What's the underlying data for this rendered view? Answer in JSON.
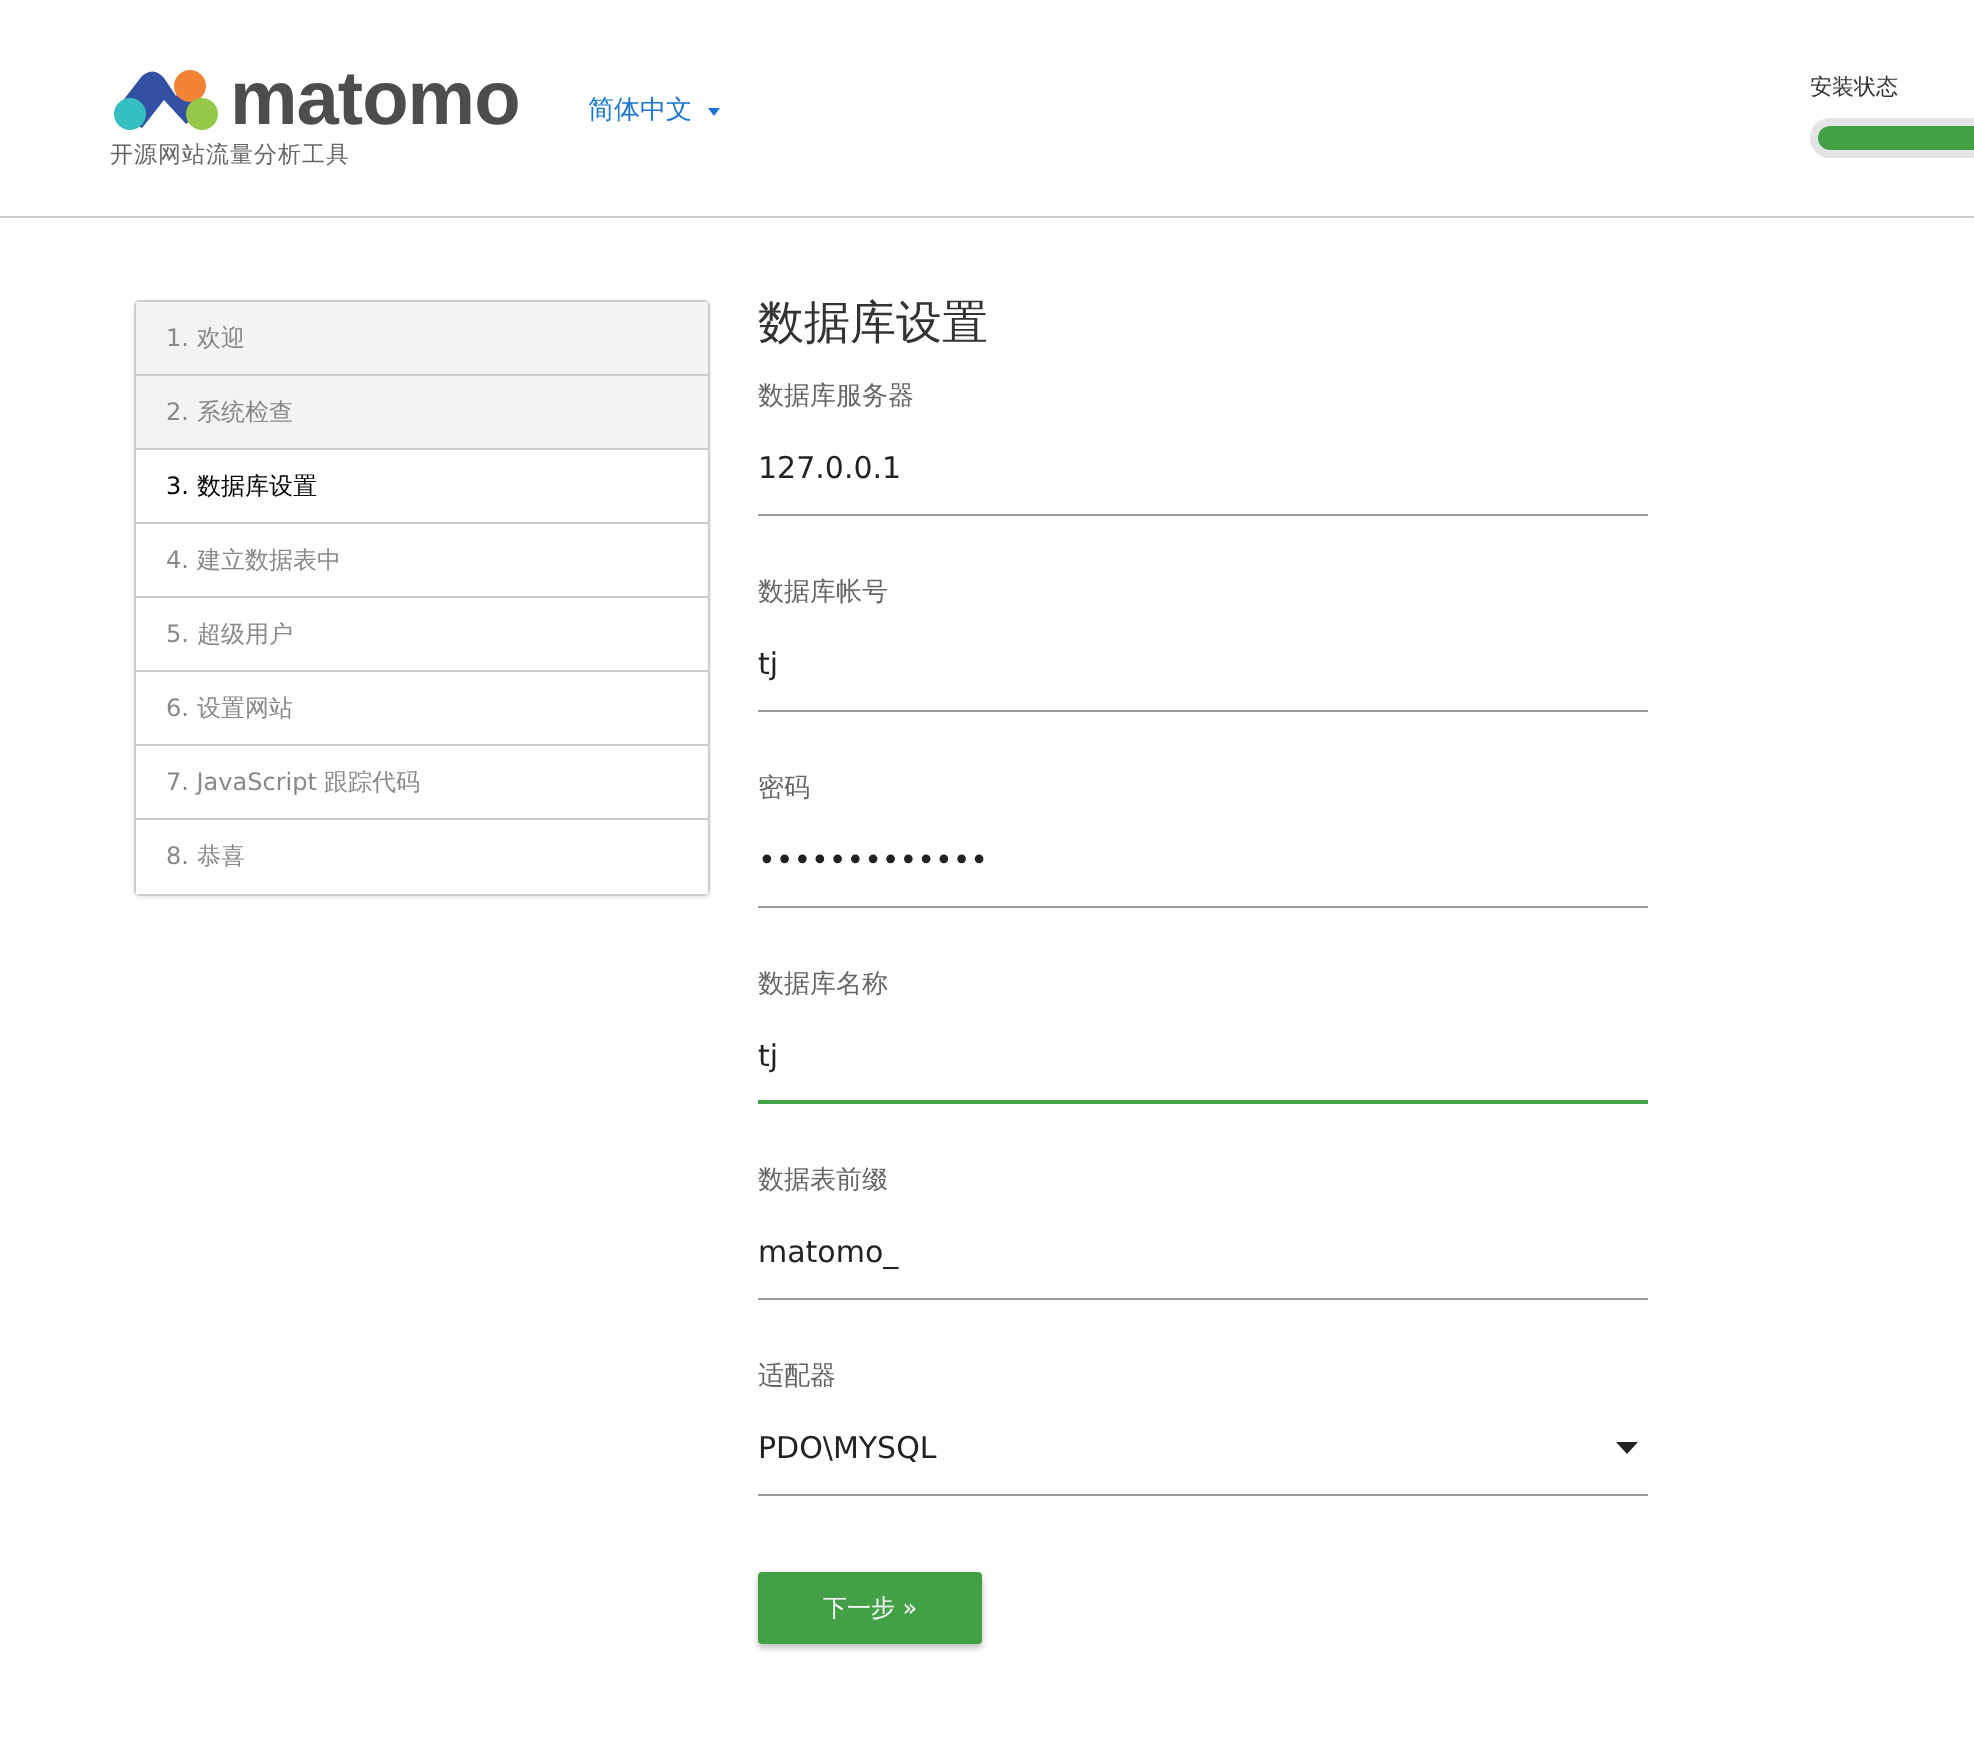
{
  "header": {
    "logo_text": "matomo",
    "tagline": "开源网站流量分析工具",
    "language": "简体中文",
    "progress": {
      "label": "安装状态",
      "level": 1
    }
  },
  "steps": [
    {
      "label": "1. 欢迎",
      "done": true,
      "selected": false
    },
    {
      "label": "2. 系统检查",
      "done": true,
      "selected": false
    },
    {
      "label": "3. 数据库设置",
      "done": false,
      "selected": true
    },
    {
      "label": "4. 建立数据表中",
      "done": false,
      "selected": false
    },
    {
      "label": "5. 超级用户",
      "done": false,
      "selected": false
    },
    {
      "label": "6. 设置网站",
      "done": false,
      "selected": false
    },
    {
      "label": "7. JavaScript 跟踪代码",
      "done": false,
      "selected": false
    },
    {
      "label": "8. 恭喜",
      "done": false,
      "selected": false
    }
  ],
  "form": {
    "title": "数据库设置",
    "fields": [
      {
        "kind": "text",
        "label": "数据库服务器",
        "value": "127.0.0.1",
        "focused": false
      },
      {
        "kind": "text",
        "label": "数据库帐号",
        "value": "tj",
        "focused": false
      },
      {
        "kind": "password",
        "label": "密码",
        "value": "•••••••••••••",
        "focused": false
      },
      {
        "kind": "text",
        "label": "数据库名称",
        "value": "tj",
        "focused": true
      },
      {
        "kind": "text",
        "label": "数据表前缀",
        "value": "matomo_",
        "focused": false
      },
      {
        "kind": "select",
        "label": "适配器",
        "value": "PDO\\MYSQL",
        "focused": false
      }
    ],
    "submit": "下一步 »"
  }
}
